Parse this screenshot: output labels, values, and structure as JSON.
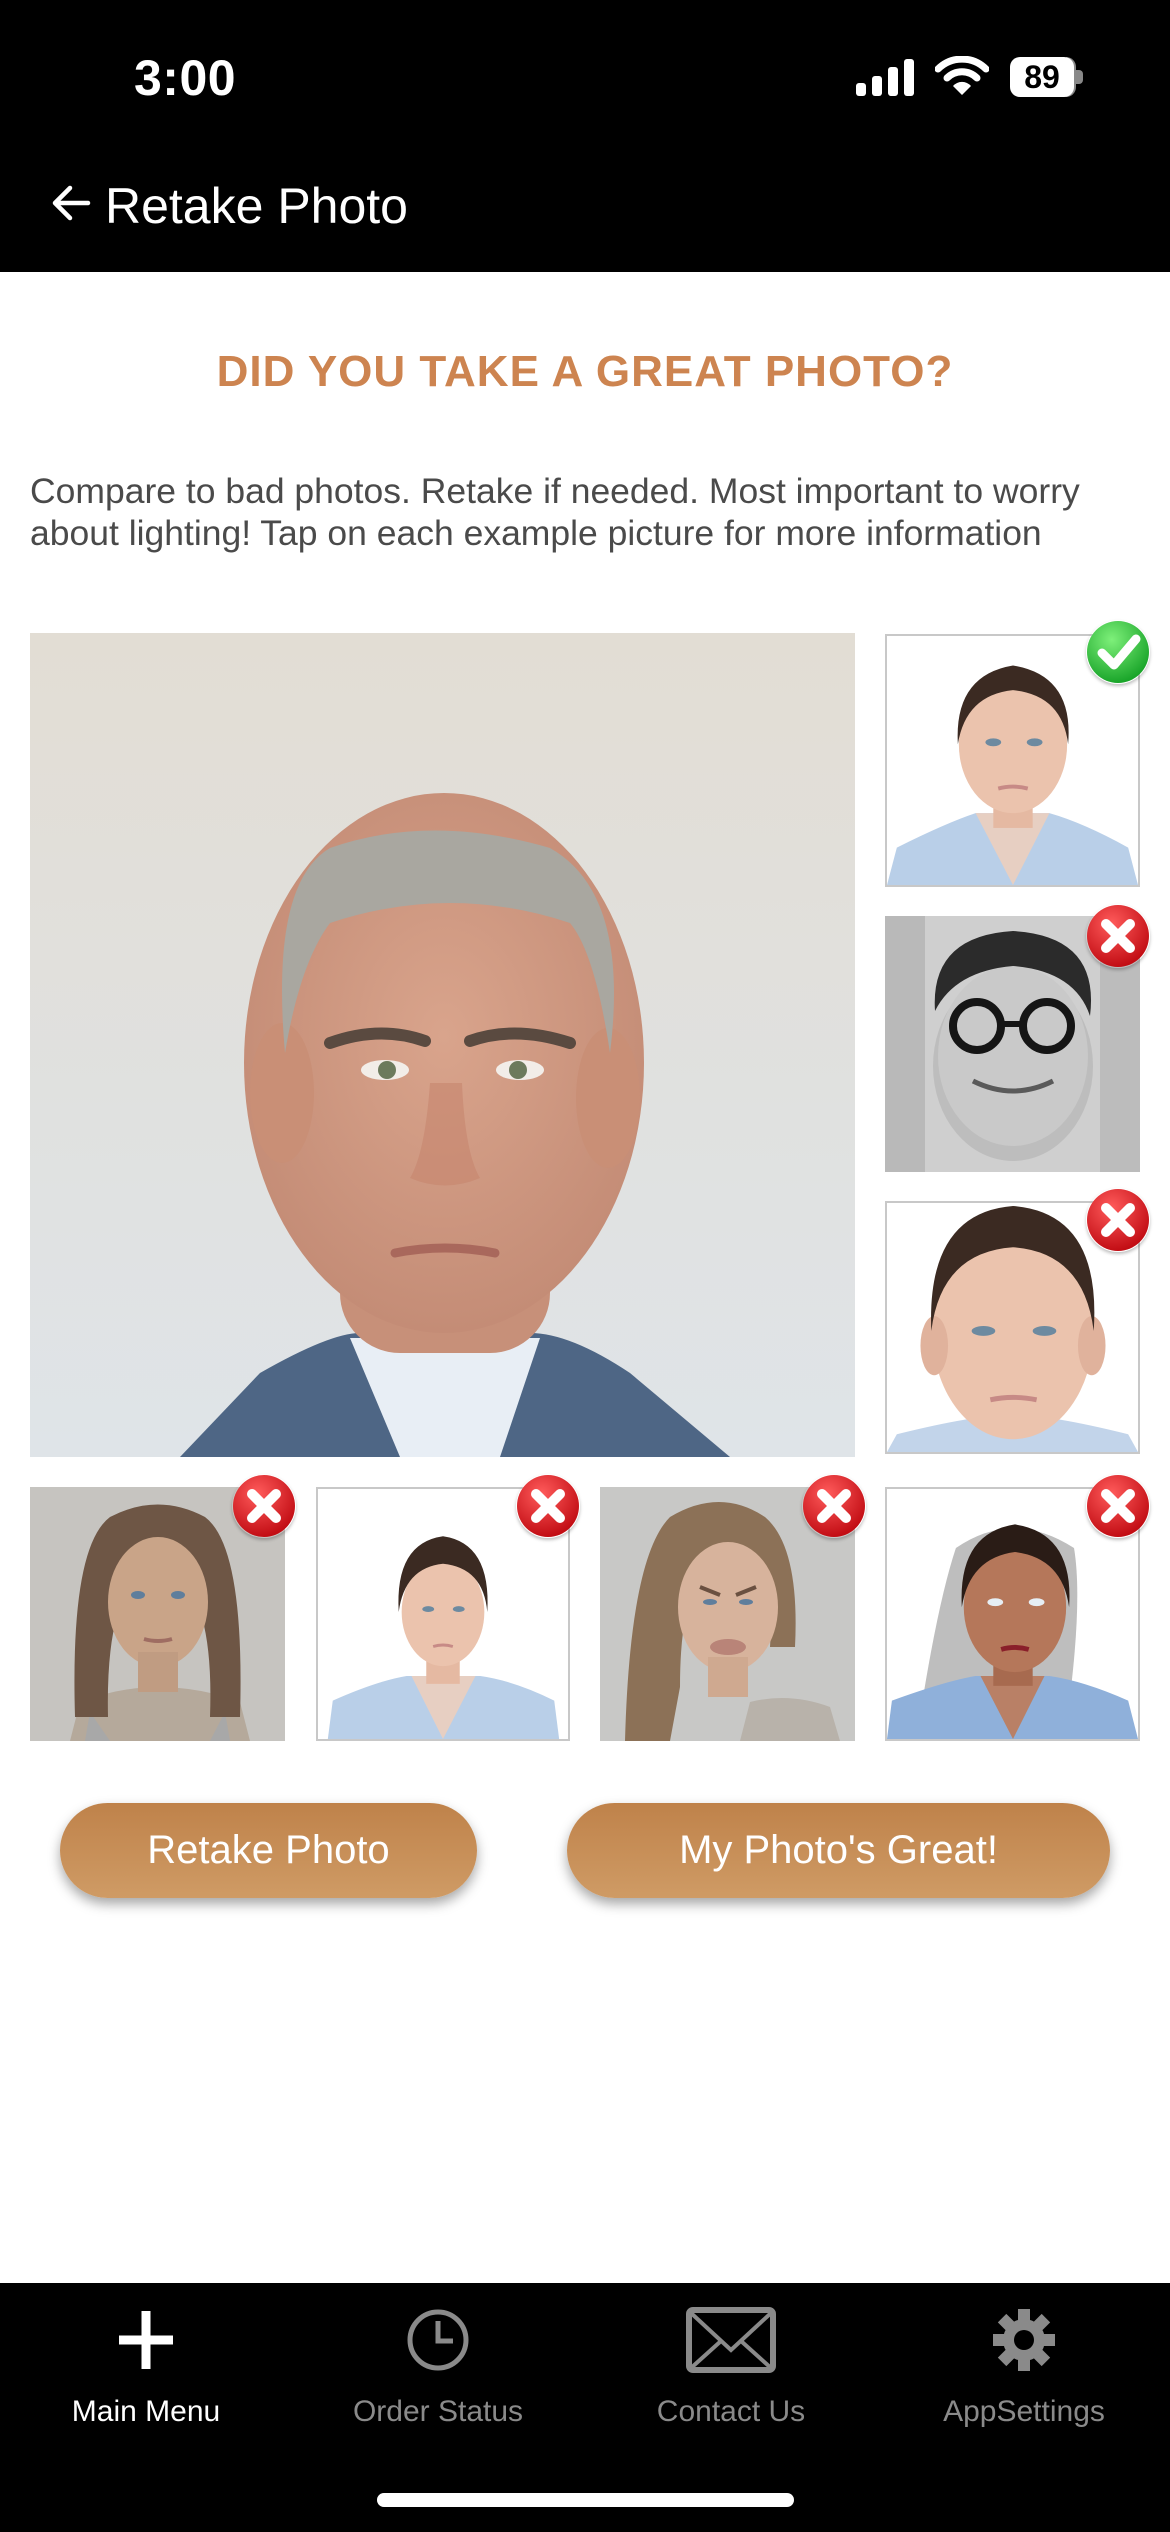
{
  "status_bar": {
    "time": "3:00",
    "battery": "89",
    "signal_icon": "cellular-signal-icon",
    "wifi_icon": "wifi-icon"
  },
  "header": {
    "back_icon": "arrow-left-icon",
    "title": "Retake Photo"
  },
  "main": {
    "title": "DID YOU TAKE A GREAT PHOTO?",
    "instructions": "Compare to bad photos.  Retake if needed.  Most important to worry about lighting!  Tap on each example picture for more information",
    "user_photo": {
      "description": "Your photo"
    },
    "examples": [
      {
        "description": "Good example photo",
        "status": "good"
      },
      {
        "description": "Bad example: glasses, smiling, busy background",
        "status": "bad"
      },
      {
        "description": "Bad example: head too close / cropped",
        "status": "bad"
      },
      {
        "description": "Bad example: gray background, poor lighting",
        "status": "bad"
      },
      {
        "description": "Bad example: head too small / far away",
        "status": "bad"
      },
      {
        "description": "Bad example: facial expression",
        "status": "bad"
      },
      {
        "description": "Bad example: shadows and dark lighting",
        "status": "bad"
      }
    ],
    "colors": {
      "accent": "#cd8450",
      "good_badge": "#2ecc40",
      "bad_badge": "#e0141e"
    }
  },
  "buttons": {
    "retake": "Retake Photo",
    "great": "My Photo's Great!"
  },
  "tabbar": {
    "items": [
      {
        "label": "Main Menu",
        "icon": "plus-icon",
        "active": true
      },
      {
        "label": "Order Status",
        "icon": "clock-icon",
        "active": false
      },
      {
        "label": "Contact Us",
        "icon": "envelope-icon",
        "active": false
      },
      {
        "label": "AppSettings",
        "icon": "gear-icon",
        "active": false
      }
    ]
  }
}
